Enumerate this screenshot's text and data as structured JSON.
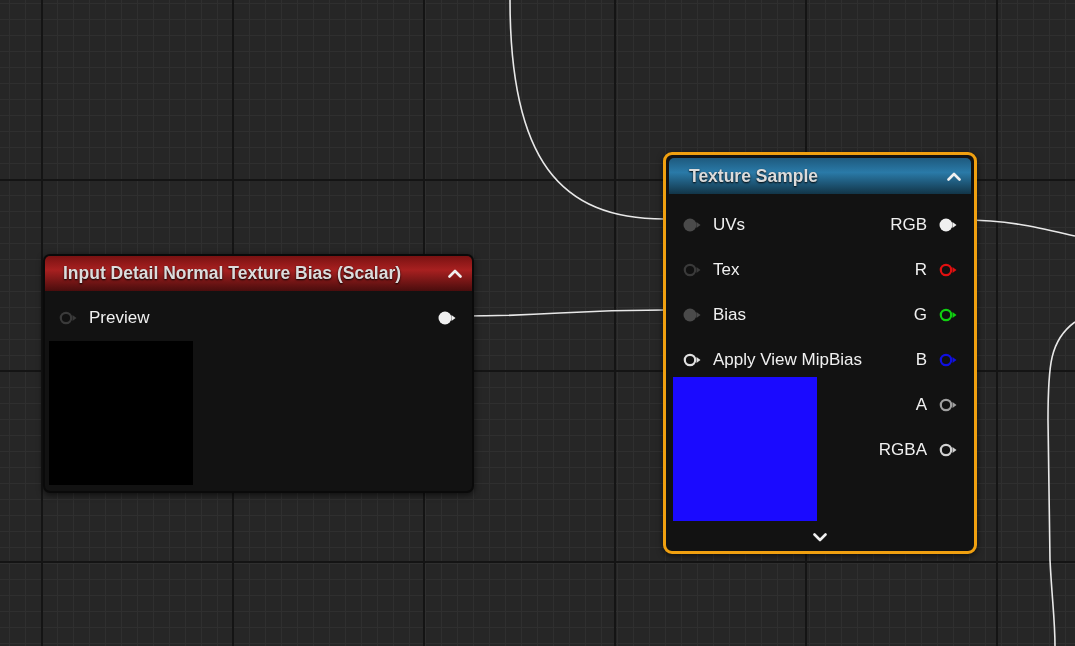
{
  "nodes": [
    {
      "title": "Input Detail Normal Texture Bias (Scalar)",
      "kind": "parameter",
      "selected": false,
      "expanded": true,
      "inputs": [
        {
          "label": "Preview",
          "connected": false,
          "color": "#3a3a3a"
        }
      ],
      "outputs": [
        {
          "connected": true,
          "color": "#f0f0f0"
        }
      ],
      "preview": {
        "color": "#000000"
      }
    },
    {
      "title": "Texture Sample",
      "kind": "texture",
      "selected": true,
      "expanded": true,
      "advanced_pins_expanded": false,
      "inputs": [
        {
          "label": "UVs",
          "connected": true,
          "color": "#4a4a4a"
        },
        {
          "label": "Tex",
          "connected": false,
          "color": "#3a3a3a"
        },
        {
          "label": "Bias",
          "connected": true,
          "color": "#4a4a4a"
        },
        {
          "label": "Apply View MipBias",
          "connected": false,
          "color": "#e0e0e0"
        }
      ],
      "outputs": [
        {
          "label": "RGB",
          "connected": true,
          "color": "#f0f0f0"
        },
        {
          "label": "R",
          "connected": false,
          "color": "#e01010"
        },
        {
          "label": "G",
          "connected": false,
          "color": "#10d010"
        },
        {
          "label": "B",
          "connected": false,
          "color": "#1010e0"
        },
        {
          "label": "A",
          "connected": false,
          "color": "#a0a0a0"
        },
        {
          "label": "RGBA",
          "connected": false,
          "color": "#d0d0d0"
        }
      ],
      "preview": {
        "color": "#1a0aff"
      }
    }
  ]
}
